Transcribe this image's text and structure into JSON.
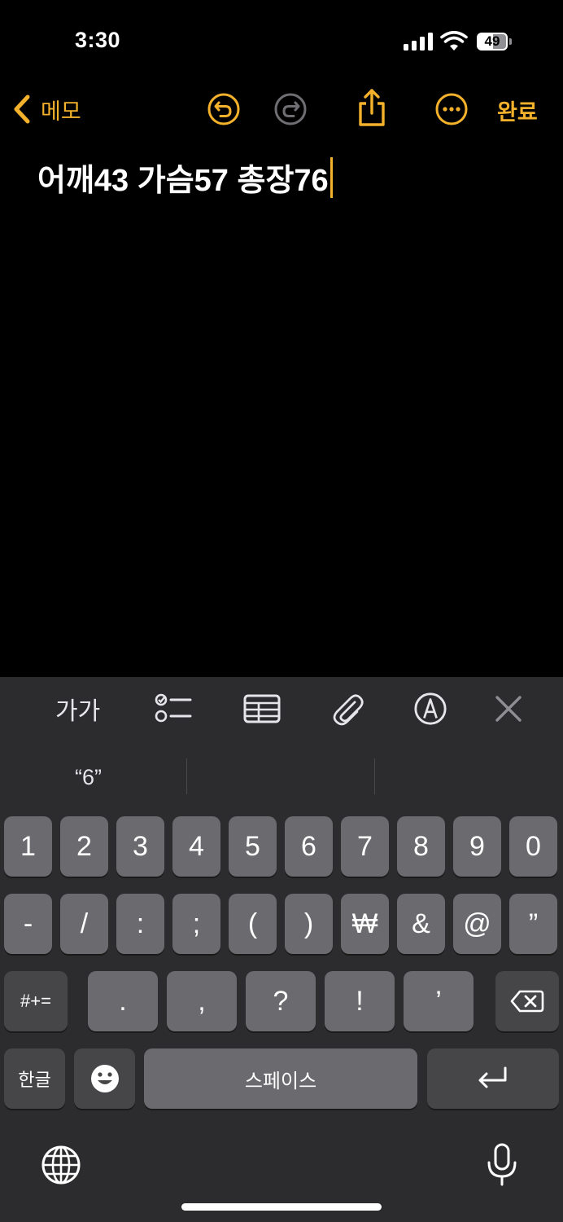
{
  "status_bar": {
    "time": "3:30",
    "battery_level": "49"
  },
  "toolbar": {
    "back_label": "메모",
    "done_label": "완료",
    "accent_color": "#f4b12c",
    "icons": [
      "undo-icon",
      "redo-icon",
      "share-icon",
      "more-icon"
    ]
  },
  "note": {
    "text": "어깨43 가슴57 총장76"
  },
  "format_bar": {
    "text_style_label": "가가",
    "icons": [
      "checklist-icon",
      "table-icon",
      "paperclip-icon",
      "markup-icon",
      "close-icon"
    ]
  },
  "keyboard": {
    "suggestion": "“6”",
    "row1": [
      "1",
      "2",
      "3",
      "4",
      "5",
      "6",
      "7",
      "8",
      "9",
      "0"
    ],
    "row2": [
      "-",
      "/",
      ":",
      ";",
      "(",
      ")",
      "₩",
      "&",
      "@",
      "”"
    ],
    "row3": [
      ".",
      ",",
      "?",
      "!",
      "’"
    ],
    "symbols_label": "#+=",
    "language_label": "한글",
    "space_label": "스페이스",
    "icons": [
      "delete-icon",
      "emoji-icon",
      "return-icon",
      "globe-icon",
      "microphone-icon"
    ]
  }
}
